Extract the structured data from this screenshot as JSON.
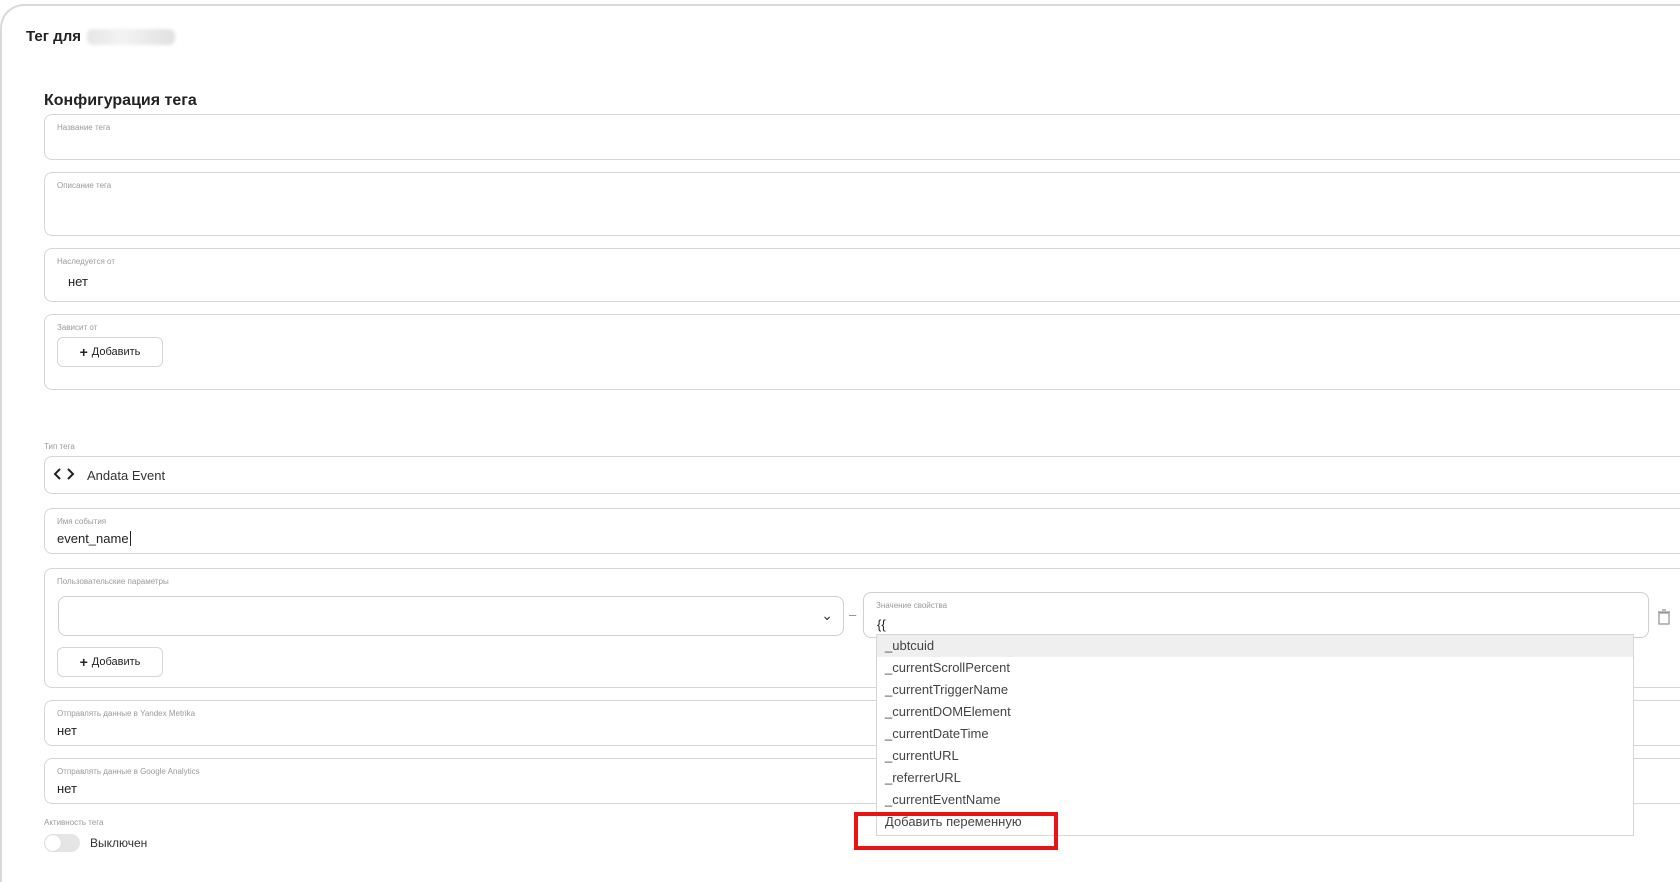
{
  "header": {
    "title": "Тег для"
  },
  "section": {
    "title": "Конфигурация тега"
  },
  "fields": {
    "tag_name": {
      "label": "Название тега",
      "value": ""
    },
    "tag_description": {
      "label": "Описание тега",
      "value": ""
    },
    "inherits_from": {
      "label": "Наследуется от",
      "value": "нет"
    },
    "depends_on": {
      "label": "Зависит от",
      "add_label": "Добавить"
    },
    "tag_type": {
      "label": "Тип тега",
      "value": "Andata Event",
      "icon": "code-brackets-icon"
    },
    "event_name": {
      "label": "Имя события",
      "value": "event_name"
    },
    "custom_params": {
      "label": "Пользовательские параметры",
      "separator": "–",
      "property_label": "Значение свойства",
      "property_value": "{{",
      "add_label": "Добавить"
    },
    "yandex_metrika": {
      "label": "Отправлять данные в Yandex Metrika",
      "value": "нет"
    },
    "google_analytics": {
      "label": "Отправлять данные в Google Analytics",
      "value": "нет"
    },
    "tag_activity": {
      "label": "Активность тега",
      "status": "Выключен"
    }
  },
  "dropdown": {
    "items": [
      "_ubtcuid",
      "_currentScrollPercent",
      "_currentTriggerName",
      "_currentDOMElement",
      "_currentDateTime",
      "_currentURL",
      "_referrerURL",
      "_currentEventName",
      "Добавить переменную"
    ]
  },
  "colors": {
    "highlight": "#ee1111",
    "border": "#d6d6d6"
  }
}
